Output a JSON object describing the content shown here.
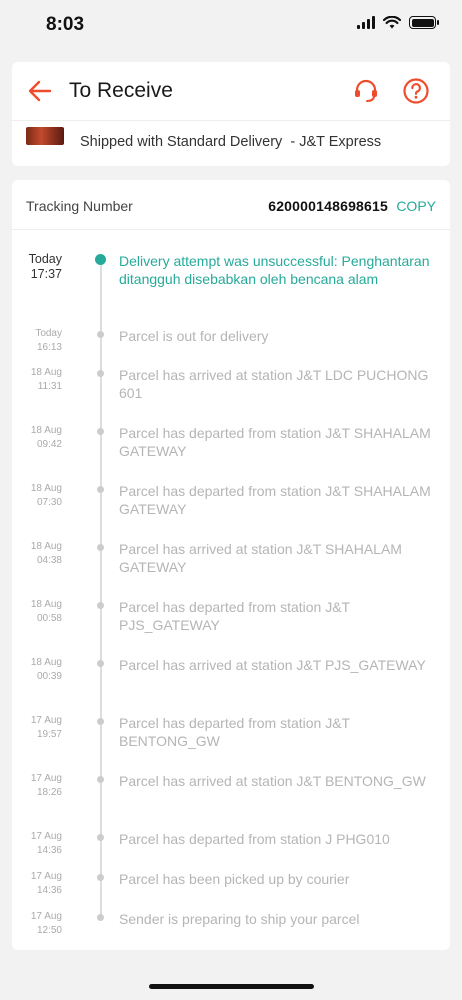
{
  "status_bar": {
    "time": "8:03"
  },
  "header": {
    "title": "To Receive"
  },
  "shipment": {
    "text": "Shipped with Standard Delivery  - J&T Express"
  },
  "tracking": {
    "label": "Tracking Number",
    "number": "620000148698615",
    "copy_label": "COPY"
  },
  "events": [
    {
      "date": "Today",
      "time": "17:37",
      "text": "Delivery attempt was unsuccessful: Penghantaran ditangguh disebabkan oleh bencana alam",
      "active": true
    },
    {
      "date": "Today",
      "time": "16:13",
      "text": "Parcel is out for delivery"
    },
    {
      "date": "18 Aug",
      "time": "11:31",
      "text": "Parcel has arrived at station J&T LDC PUCHONG 601"
    },
    {
      "date": "18 Aug",
      "time": "09:42",
      "text": "Parcel has departed from station J&T SHAHALAM GATEWAY"
    },
    {
      "date": "18 Aug",
      "time": "07:30",
      "text": "Parcel has departed from station J&T SHAHALAM GATEWAY"
    },
    {
      "date": "18 Aug",
      "time": "04:38",
      "text": "Parcel has arrived at station J&T SHAHALAM GATEWAY"
    },
    {
      "date": "18 Aug",
      "time": "00:58",
      "text": "Parcel has departed from station J&T PJS_GATEWAY"
    },
    {
      "date": "18 Aug",
      "time": "00:39",
      "text": "Parcel has arrived at station J&T PJS_GATEWAY"
    },
    {
      "date": "17 Aug",
      "time": "19:57",
      "text": "Parcel has departed from station J&T BENTONG_GW"
    },
    {
      "date": "17 Aug",
      "time": "18:26",
      "text": "Parcel has arrived at station J&T BENTONG_GW"
    },
    {
      "date": "17 Aug",
      "time": "14:36",
      "text": "Parcel has departed from station J PHG010"
    },
    {
      "date": "17 Aug",
      "time": "14:36",
      "text": "Parcel has been picked up by courier"
    },
    {
      "date": "17 Aug",
      "time": "12:50",
      "text": "Sender is preparing to ship your parcel"
    }
  ],
  "colors": {
    "accent": "#ee4d2d",
    "active_green": "#26aa99",
    "muted_text": "#b5b5b5"
  },
  "icons": {
    "back": "arrow-left-icon",
    "support": "headset-icon",
    "help": "question-circle-icon"
  }
}
